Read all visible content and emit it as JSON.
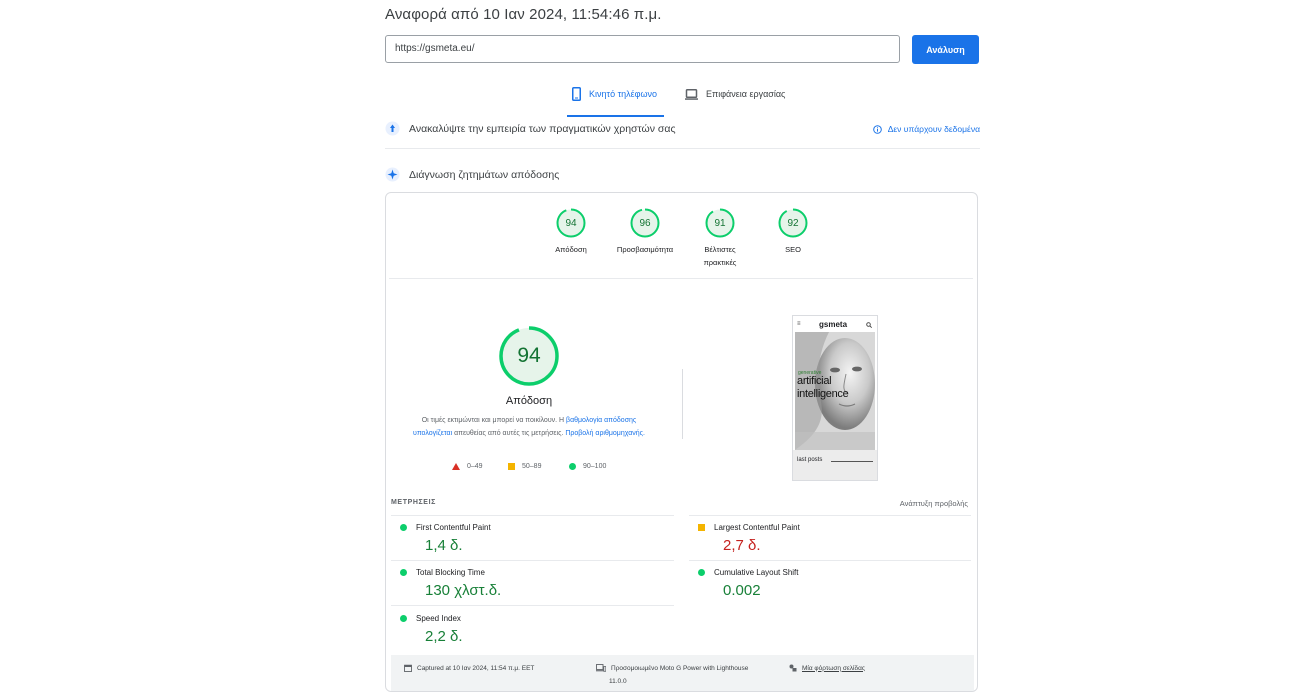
{
  "header": {
    "report_title": "Αναφορά από 10 Ιαν 2024, 11:54:46 π.μ.",
    "url_value": "https://gsmeta.eu/",
    "analyze_label": "Ανάλυση"
  },
  "tabs": [
    {
      "label": "Κινητό τηλέφωνο",
      "active": true,
      "icon": "smartphone-icon"
    },
    {
      "label": "Επιφάνεια εργασίας",
      "active": false,
      "icon": "laptop-icon"
    }
  ],
  "field_data": {
    "label": "Ανακαλύψτε την εμπειρία των πραγματικών χρηστών σας",
    "no_data_label": "Δεν υπάρχουν δεδομένα"
  },
  "diagnose": {
    "label": "Διάγνωση ζητημάτων απόδοσης"
  },
  "scores": [
    {
      "value": "94",
      "label": "Απόδοση"
    },
    {
      "value": "96",
      "label": "Προσβασιμότητα"
    },
    {
      "value": "91",
      "label": "Βέλτιστες πρακτικές"
    },
    {
      "value": "92",
      "label": "SEO"
    }
  ],
  "performance": {
    "score": "94",
    "title": "Απόδοση",
    "desc_1": "Οι τιμές εκτιμώνται και μπορεί να ποικίλουν. Η ",
    "desc_link_1": "βαθμολογία απόδοσης υπολογίζεται",
    "desc_2": " απευθείας από αυτές τις μετρήσεις. ",
    "desc_link_2": "Προβολή αριθμομηχανής.",
    "legend": [
      {
        "label": "0–49",
        "shape": "triangle",
        "color": "#d93025"
      },
      {
        "label": "50–89",
        "shape": "square",
        "color": "#f4b400"
      },
      {
        "label": "90–100",
        "shape": "circle",
        "color": "#0cce6b"
      }
    ]
  },
  "screenshot": {
    "logo_text": "gsmeta",
    "headline_1": "artificial",
    "headline_2": "intelligence",
    "tag": "generative",
    "footer_text": "last posts"
  },
  "metrics": {
    "header": "ΜΕΤΡΗΣΕΙΣ",
    "expand_label": "Ανάπτυξη προβολής",
    "items": [
      {
        "name": "First Contentful Paint",
        "value": "1,4 δ.",
        "status": "good"
      },
      {
        "name": "Largest Contentful Paint",
        "value": "2,7 δ.",
        "status": "average"
      },
      {
        "name": "Total Blocking Time",
        "value": "130 χλστ.δ.",
        "status": "good"
      },
      {
        "name": "Cumulative Layout Shift",
        "value": "0.002",
        "status": "good"
      },
      {
        "name": "Speed Index",
        "value": "2,2 δ.",
        "status": "good"
      }
    ]
  },
  "footer": {
    "captured": "Captured at 10 Ιαν 2024, 11:54 π.μ. EET",
    "device": "Προσομοιωμένο Moto G Power with Lighthouse",
    "device_version": "11.0.0",
    "load": "Μία φόρτωση σελίδας"
  },
  "colors": {
    "accent": "#1a73e8",
    "pass": "#0cce6b",
    "pass_text": "#188038",
    "average": "#f4b400",
    "fail": "#d93025"
  }
}
